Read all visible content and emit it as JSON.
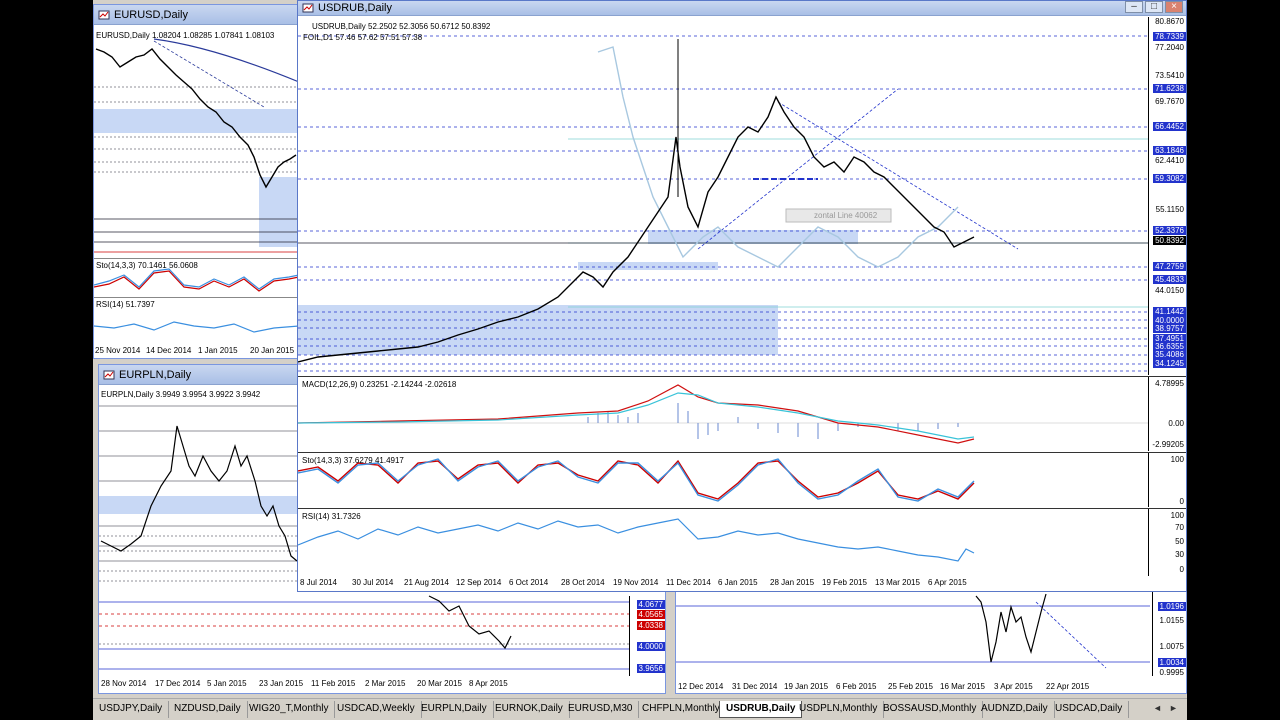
{
  "windows": {
    "eurusd": {
      "title": "EURUSD,Daily",
      "header": "EURUSD,Daily  1.08204 1.08285 1.07841 1.08103",
      "sto_label": "Sto(14,3,3) 70.1461 56.0608",
      "rsi_label": "RSI(14) 51.7397",
      "dates": [
        "25 Nov 2014",
        "14 Dec 2014",
        "1 Jan 2015",
        "20 Jan 2015"
      ]
    },
    "eurpln": {
      "title": "EURPLN,Daily",
      "header": "EURPLN,Daily  3.9949 3.9954 3.9922 3.9942",
      "price_labels": [
        "4.0677",
        "4.0565",
        "4.0338",
        "4.0000",
        "3.9656"
      ],
      "dates": [
        "28 Nov 2014",
        "17 Dec 2014",
        "5 Jan 2015",
        "23 Jan 2015",
        "11 Feb 2015",
        "2 Mar 2015",
        "20 Mar 2015",
        "8 Apr 2015"
      ]
    },
    "usdrub": {
      "title": "USDRUB,Daily",
      "header": "USDRUB,Daily  52.2502 52.3056 50.6712 50.8392",
      "foil": "FOIL,D1 57.46 57.62 57.51 57.38",
      "tooltip": "zontal Line 40062",
      "price_scale": [
        "80.8670",
        "77.2040",
        "73.5410",
        "69.7670",
        "62.4410",
        "55.1150",
        "44.0150"
      ],
      "price_highlights": [
        {
          "text": "78.7339",
          "color": "#2233cc"
        },
        {
          "text": "71.6238",
          "color": "#2233cc"
        },
        {
          "text": "66.4452",
          "color": "#2233cc"
        },
        {
          "text": "63.1846",
          "color": "#2233cc"
        },
        {
          "text": "59.3082",
          "color": "#2233cc"
        },
        {
          "text": "52.3376",
          "color": "#2233cc"
        },
        {
          "text": "50.8392",
          "color": "#000000"
        },
        {
          "text": "47.2759",
          "color": "#2233cc"
        },
        {
          "text": "45.4833",
          "color": "#2233cc"
        },
        {
          "text": "41.1442",
          "color": "#2233cc"
        },
        {
          "text": "40.0000",
          "color": "#2233cc"
        },
        {
          "text": "38.9757",
          "color": "#2233cc"
        },
        {
          "text": "37.4951",
          "color": "#2233cc"
        },
        {
          "text": "36.6355",
          "color": "#2233cc"
        },
        {
          "text": "35.4086",
          "color": "#2233cc"
        },
        {
          "text": "34.1245",
          "color": "#2233cc"
        }
      ],
      "macd_label": "MACD(12,26,9) 0.23251 -2.14244 -2.02618",
      "macd_scale": [
        "4.78995",
        "0.00",
        "-2.99205"
      ],
      "sto_label": "Sto(14,3,3) 37.6279 41.4917",
      "sto_scale": [
        "100",
        "0"
      ],
      "rsi_label": "RSI(14) 31.7326",
      "rsi_scale": [
        "100",
        "70",
        "50",
        "30",
        "0"
      ],
      "dates": [
        "8 Jul 2014",
        "30 Jul 2014",
        "21 Aug 2014",
        "12 Sep 2014",
        "6 Oct 2014",
        "28 Oct 2014",
        "19 Nov 2014",
        "11 Dec 2014",
        "6 Jan 2015",
        "28 Jan 2015",
        "19 Feb 2015",
        "13 Mar 2015",
        "6 Apr 2015"
      ]
    },
    "bottom_right": {
      "price_labels": [
        "1.0196",
        "1.0155",
        "1.0075",
        "1.0034",
        "0.9995"
      ],
      "dates": [
        "12 Dec 2014",
        "31 Dec 2014",
        "19 Jan 2015",
        "6 Feb 2015",
        "25 Feb 2015",
        "16 Mar 2015",
        "3 Apr 2015",
        "22 Apr 2015"
      ]
    }
  },
  "tabs": [
    "USDJPY,Daily",
    "NZDUSD,Daily",
    "WIG20_T,Monthly",
    "USDCAD,Weekly",
    "EURPLN,Daily",
    "EURNOK,Daily",
    "EURUSD,M30",
    "CHFPLN,Monthly",
    "USDRUB,Daily",
    "USDPLN,Monthly",
    "BOSSAUSD,Monthly",
    "AUDNZD,Daily",
    "USDCAD,Daily"
  ],
  "active_tab": "USDRUB,Daily",
  "colors": {
    "bull_area": "#c8d8f5",
    "accent": "#2233cc",
    "macd_signal": "#d01010",
    "sto_k": "#3a8fe0"
  }
}
